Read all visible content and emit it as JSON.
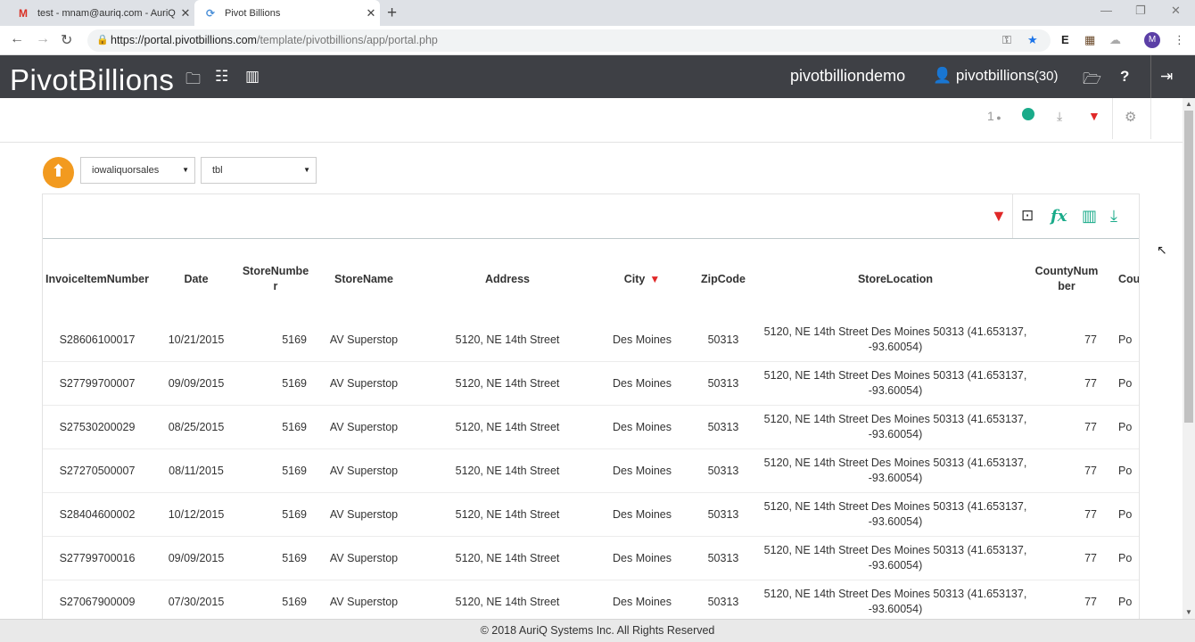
{
  "browser": {
    "tabs": [
      {
        "title": "test - mnam@auriq.com - AuriQ",
        "favicon": "M"
      },
      {
        "title": "Pivot Billions",
        "favicon": "pivot-icon"
      }
    ],
    "url_host": "https://portal.pivotbillions.com",
    "url_path": "/template/pivotbillions/app/portal.php",
    "profile_initial": "M"
  },
  "app": {
    "brand": "PivotBillions",
    "workspace": "pivotbilliondemo",
    "user": "pivotbillions",
    "user_count": "(30)",
    "toolbar_user_count": "1"
  },
  "selectors": {
    "dataset": "iowaliquorsales",
    "table": "tbl"
  },
  "table": {
    "columns": [
      "InvoiceItemNumber",
      "Date",
      "StoreNumber",
      "StoreName",
      "Address",
      "City",
      "ZipCode",
      "StoreLocation",
      "CountyNumber",
      "County"
    ],
    "column_display": [
      "InvoiceItemNumber",
      "Date",
      "StoreNumbe\nr",
      "StoreName",
      "Address",
      "City",
      "ZipCode",
      "StoreLocation",
      "CountyNum\nber",
      "Cou"
    ],
    "rows": [
      [
        "S28606100017",
        "10/21/2015",
        "5169",
        "AV Superstop",
        "5120, NE 14th Street",
        "Des Moines",
        "50313",
        "5120, NE 14th Street Des Moines 50313 (41.653137, -93.60054)",
        "77",
        "Po"
      ],
      [
        "S27799700007",
        "09/09/2015",
        "5169",
        "AV Superstop",
        "5120, NE 14th Street",
        "Des Moines",
        "50313",
        "5120, NE 14th Street Des Moines 50313 (41.653137, -93.60054)",
        "77",
        "Po"
      ],
      [
        "S27530200029",
        "08/25/2015",
        "5169",
        "AV Superstop",
        "5120, NE 14th Street",
        "Des Moines",
        "50313",
        "5120, NE 14th Street Des Moines 50313 (41.653137, -93.60054)",
        "77",
        "Po"
      ],
      [
        "S27270500007",
        "08/11/2015",
        "5169",
        "AV Superstop",
        "5120, NE 14th Street",
        "Des Moines",
        "50313",
        "5120, NE 14th Street Des Moines 50313 (41.653137, -93.60054)",
        "77",
        "Po"
      ],
      [
        "S28404600002",
        "10/12/2015",
        "5169",
        "AV Superstop",
        "5120, NE 14th Street",
        "Des Moines",
        "50313",
        "5120, NE 14th Street Des Moines 50313 (41.653137, -93.60054)",
        "77",
        "Po"
      ],
      [
        "S27799700016",
        "09/09/2015",
        "5169",
        "AV Superstop",
        "5120, NE 14th Street",
        "Des Moines",
        "50313",
        "5120, NE 14th Street Des Moines 50313 (41.653137, -93.60054)",
        "77",
        "Po"
      ],
      [
        "S27067900009",
        "07/30/2015",
        "5169",
        "AV Superstop",
        "5120, NE 14th Street",
        "Des Moines",
        "50313",
        "5120, NE 14th Street Des Moines 50313 (41.653137, -93.60054)",
        "77",
        "Po"
      ]
    ]
  },
  "footer": "© 2018 AuriQ Systems Inc. All Rights Reserved",
  "colors": {
    "header_bg": "#3e4045",
    "accent_orange": "#f29a1f",
    "filter_red": "#e02828",
    "accent_teal": "#1aab8a"
  }
}
